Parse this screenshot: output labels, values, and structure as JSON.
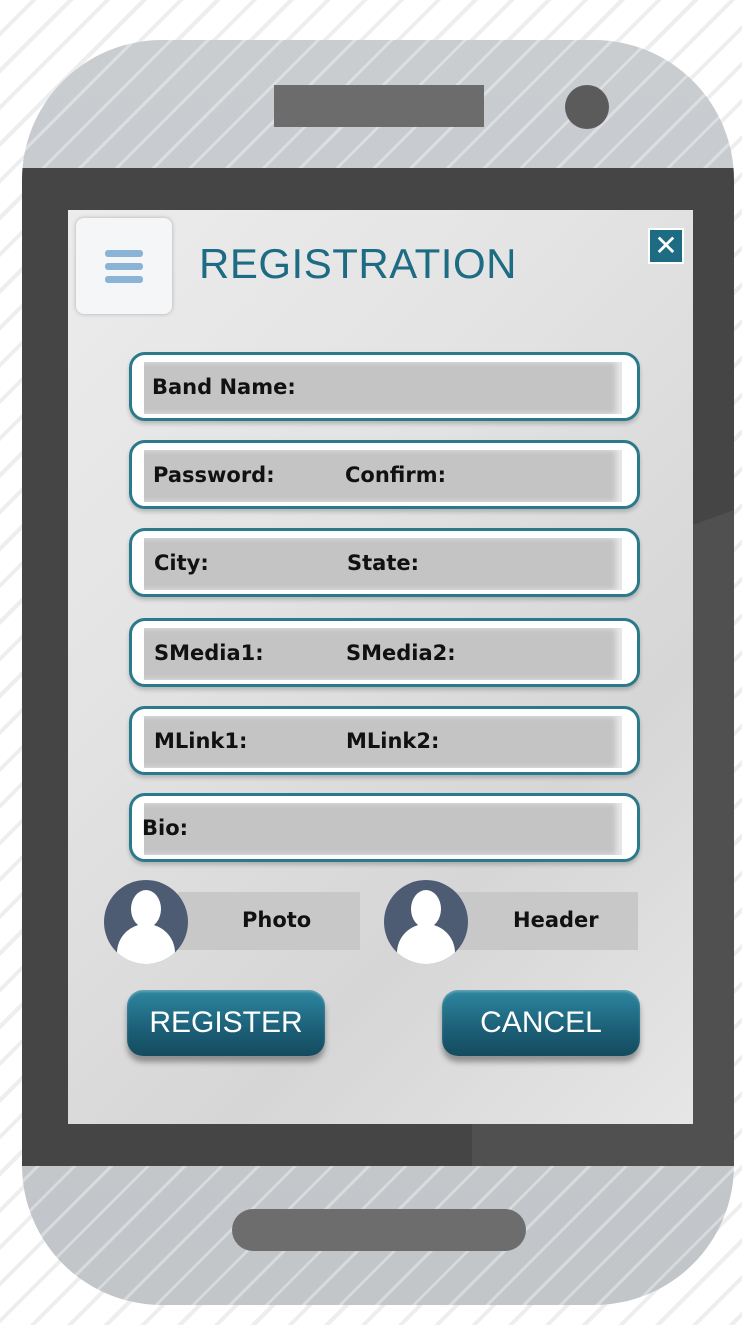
{
  "screen": {
    "title": "REGISTRATION",
    "close_symbol": "✕",
    "menu_icon": "hamburger-icon",
    "fields": [
      {
        "labels": [
          "Band Name:"
        ]
      },
      {
        "labels": [
          "Password:",
          "Confirm:"
        ]
      },
      {
        "labels": [
          "City:",
          "State:"
        ]
      },
      {
        "labels": [
          "SMedia1:",
          "SMedia2:"
        ]
      },
      {
        "labels": [
          "MLink1:",
          "MLink2:"
        ]
      },
      {
        "labels": [
          "Bio:"
        ]
      }
    ],
    "uploads": {
      "photo_label": "Photo",
      "header_label": "Header"
    },
    "buttons": {
      "register_label": "REGISTER",
      "cancel_label": "CANCEL"
    }
  },
  "colors": {
    "accent": "#1e6c83",
    "field_border": "#2a7a8c",
    "field_fill": "#c4c4c4",
    "avatar": "#4d5c73",
    "bezel": "#454545"
  }
}
